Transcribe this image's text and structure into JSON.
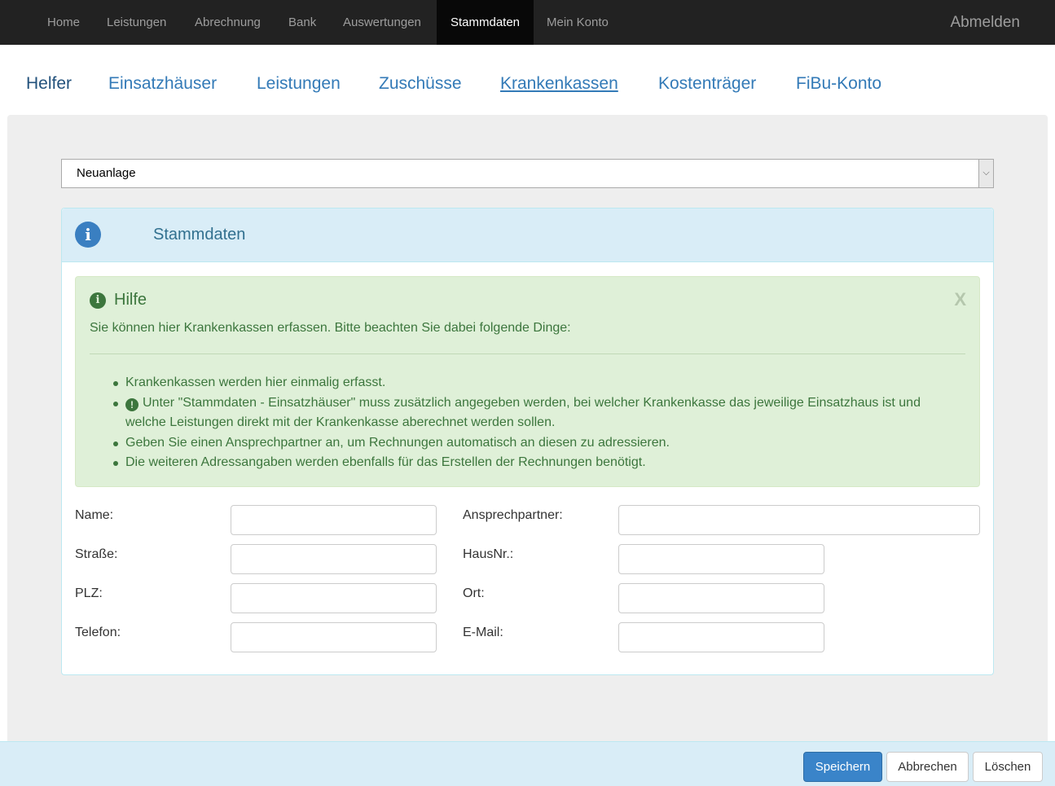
{
  "navbar": {
    "items": [
      {
        "label": "Home"
      },
      {
        "label": "Leistungen"
      },
      {
        "label": "Abrechnung"
      },
      {
        "label": "Bank"
      },
      {
        "label": "Auswertungen"
      },
      {
        "label": "Stammdaten"
      },
      {
        "label": "Mein Konto"
      }
    ],
    "active": "Stammdaten",
    "logout_label": "Abmelden"
  },
  "subtabs": {
    "items": [
      {
        "label": "Helfer"
      },
      {
        "label": "Einsatzhäuser"
      },
      {
        "label": "Leistungen"
      },
      {
        "label": "Zuschüsse"
      },
      {
        "label": "Krankenkassen"
      },
      {
        "label": "Kostenträger"
      },
      {
        "label": "FiBu-Konto"
      }
    ],
    "selected": "Krankenkassen"
  },
  "record_select": {
    "value": "Neuanlage"
  },
  "panel": {
    "title": "Stammdaten",
    "icon": "info-icon"
  },
  "help": {
    "title": "Hilfe",
    "close_label": "X",
    "intro": "Sie können hier Krankenkassen erfassen. Bitte beachten Sie dabei folgende Dinge:",
    "bullets": [
      "Krankenkassen werden hier einmalig erfasst.",
      "Unter \"Stammdaten - Einsatzhäuser\" muss zusätzlich angegeben werden, bei welcher Krankenkasse das jeweilige Einsatzhaus ist und welche Leistungen direkt mit der Krankenkasse aberechnet werden sollen.",
      "Geben Sie einen Ansprechpartner an, um Rechnungen automatisch an diesen zu adressieren.",
      "Die weiteren Adressangaben werden ebenfalls für das Erstellen der Rechnungen benötigt."
    ],
    "warn_icon": "!"
  },
  "form": {
    "name": {
      "label": "Name:",
      "value": ""
    },
    "contact": {
      "label": "Ansprechpartner:",
      "value": ""
    },
    "street": {
      "label": "Straße:",
      "value": ""
    },
    "house_no": {
      "label": "HausNr.:",
      "value": ""
    },
    "zip": {
      "label": "PLZ:",
      "value": ""
    },
    "city": {
      "label": "Ort:",
      "value": ""
    },
    "phone": {
      "label": "Telefon:",
      "value": ""
    },
    "email": {
      "label": "E-Mail:",
      "value": ""
    }
  },
  "footer": {
    "save_label": "Speichern",
    "cancel_label": "Abbrechen",
    "delete_label": "Löschen"
  },
  "colors": {
    "navbar_bg": "#222222",
    "link": "#337ab7",
    "info_panel": "#d9edf7",
    "help_bg": "#dff0d8",
    "help_text": "#3c763d",
    "primary_button": "#3a84c9"
  }
}
